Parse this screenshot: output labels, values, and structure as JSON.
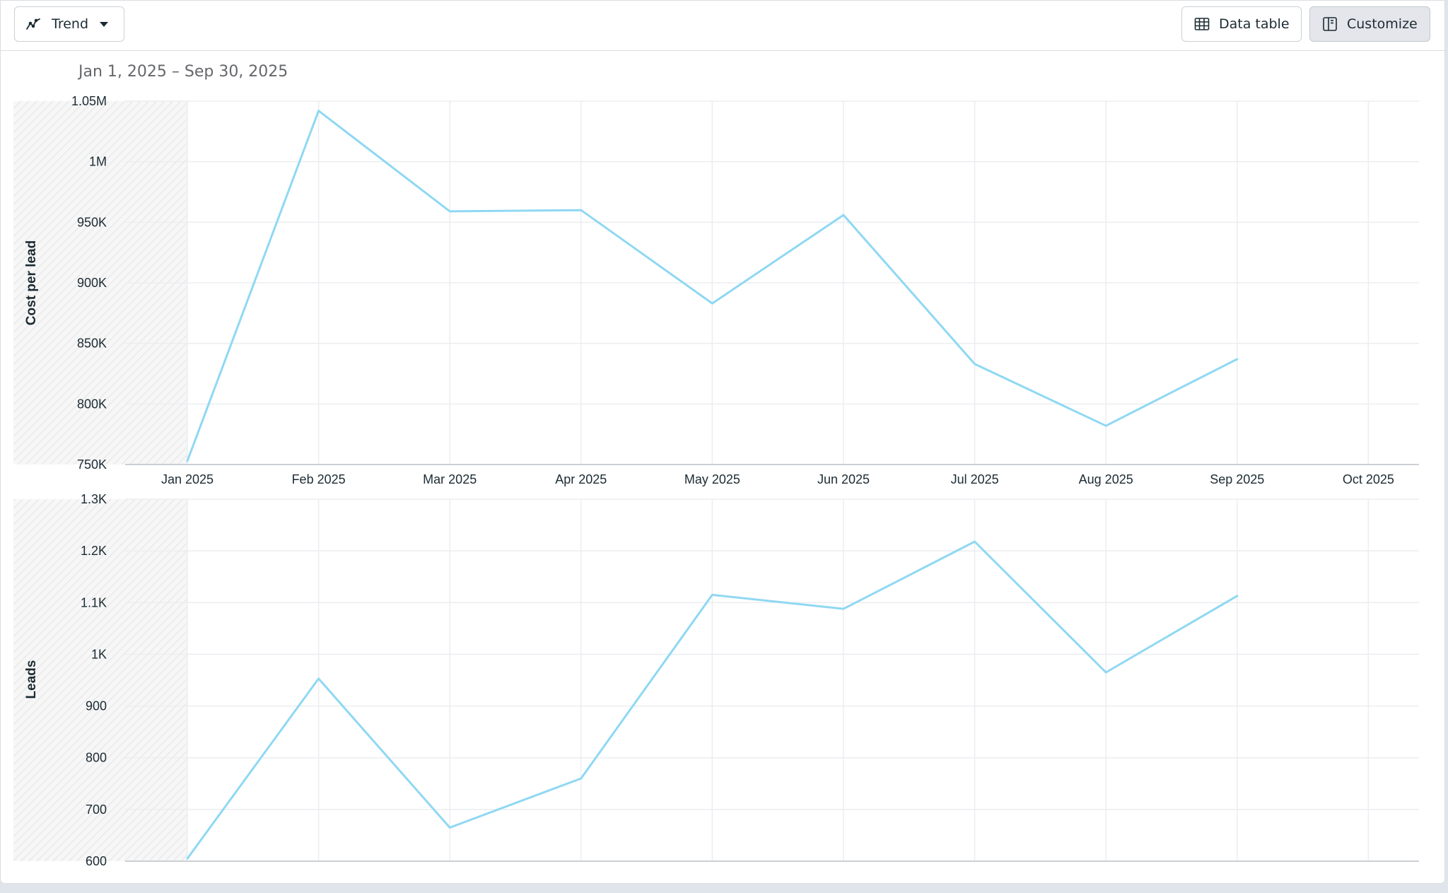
{
  "toolbar": {
    "view_label": "Trend",
    "data_table_label": "Data table",
    "customize_label": "Customize"
  },
  "date_range": "Jan 1, 2025 – Sep 30, 2025",
  "colors": {
    "line": "#8fd8f3",
    "grid": "#ebedf0",
    "axis_text": "#1c2b33",
    "hatch": "#e6e6e6"
  },
  "icons": {
    "view": "trend-line-icon",
    "caret": "caret-down-icon",
    "table": "table-icon",
    "customize": "panel-icon"
  },
  "chart_data": [
    {
      "type": "line",
      "title": "",
      "xlabel": "",
      "ylabel": "Cost per lead",
      "categories": [
        "Jan 2025",
        "Feb 2025",
        "Mar 2025",
        "Apr 2025",
        "May 2025",
        "Jun 2025",
        "Jul 2025",
        "Aug 2025",
        "Sep 2025",
        "Oct 2025"
      ],
      "series": [
        {
          "values": [
            753000,
            1042000,
            959000,
            960000,
            883000,
            956000,
            833000,
            782000,
            837000,
            null
          ]
        }
      ],
      "yticks": [
        750000,
        800000,
        850000,
        900000,
        950000,
        1000000,
        1050000
      ],
      "ytick_labels": [
        "750K",
        "800K",
        "850K",
        "900K",
        "950K",
        "1M",
        "1.05M"
      ],
      "ylim": [
        750000,
        1050000
      ],
      "grid": true
    },
    {
      "type": "line",
      "title": "",
      "xlabel": "",
      "ylabel": "Leads",
      "categories": [
        "Jan 2025",
        "Feb 2025",
        "Mar 2025",
        "Apr 2025",
        "May 2025",
        "Jun 2025",
        "Jul 2025",
        "Aug 2025",
        "Sep 2025",
        "Oct 2025"
      ],
      "series": [
        {
          "values": [
            605,
            953,
            665,
            760,
            1115,
            1088,
            1218,
            965,
            1113,
            null
          ]
        }
      ],
      "yticks": [
        600,
        700,
        800,
        900,
        1000,
        1100,
        1200,
        1300
      ],
      "ytick_labels": [
        "600",
        "700",
        "800",
        "900",
        "1K",
        "1.1K",
        "1.2K",
        "1.3K"
      ],
      "ylim": [
        600,
        1300
      ],
      "grid": true
    }
  ]
}
